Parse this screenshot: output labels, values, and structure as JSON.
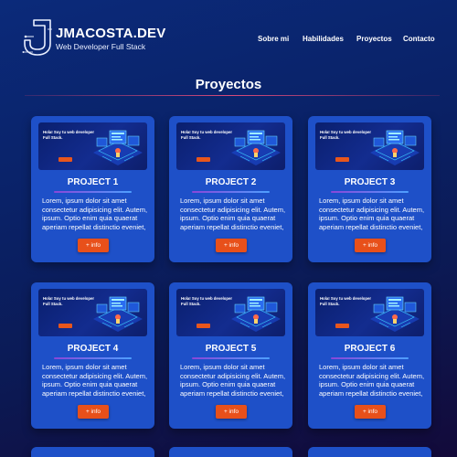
{
  "header": {
    "brand_name": "JMACOSTA.DEV",
    "brand_subtitle": "Web Developer Full Stack",
    "nav": [
      "Sobre mi",
      "Habilidades",
      "Proyectos",
      "Contacto"
    ]
  },
  "main": {
    "title": "Proyectos",
    "projects": [
      {
        "thumb_text": "Hola! Soy tu web developer Full Stack.",
        "title": "PROJECT 1",
        "description": "Lorem, ipsum dolor sit amet consectetur adipisicing elit. Autem, ipsum. Optio enim quia quaerat aperiam repellat distinctio eveniet,",
        "button": "+ info"
      },
      {
        "thumb_text": "Hola! Soy tu web developer Full Stack.",
        "title": "PROJECT 2",
        "description": "Lorem, ipsum dolor sit amet consectetur adipisicing elit. Autem, ipsum. Optio enim quia quaerat aperiam repellat distinctio eveniet,",
        "button": "+ info"
      },
      {
        "thumb_text": "Hola! Soy tu web developer Full Stack.",
        "title": "PROJECT 3",
        "description": "Lorem, ipsum dolor sit amet consectetur adipisicing elit. Autem, ipsum. Optio enim quia quaerat aperiam repellat distinctio eveniet,",
        "button": "+ info"
      },
      {
        "thumb_text": "Hola! Soy tu web developer Full Stack.",
        "title": "PROJECT 4",
        "description": "Lorem, ipsum dolor sit amet consectetur adipisicing elit. Autem, ipsum. Optio enim quia quaerat aperiam repellat distinctio eveniet,",
        "button": "+ info"
      },
      {
        "thumb_text": "Hola! Soy tu web developer Full Stack.",
        "title": "PROJECT 5",
        "description": "Lorem, ipsum dolor sit amet consectetur adipisicing elit. Autem, ipsum. Optio enim quia quaerat aperiam repellat distinctio eveniet,",
        "button": "+ info"
      },
      {
        "thumb_text": "Hola! Soy tu web developer Full Stack.",
        "title": "PROJECT 6",
        "description": "Lorem, ipsum dolor sit amet consectetur adipisicing elit. Autem, ipsum. Optio enim quia quaerat aperiam repellat distinctio eveniet,",
        "button": "+ info"
      }
    ]
  },
  "colors": {
    "card": "#1e50c8",
    "button": "#e8501a",
    "title_rule": "#d84a7a"
  }
}
